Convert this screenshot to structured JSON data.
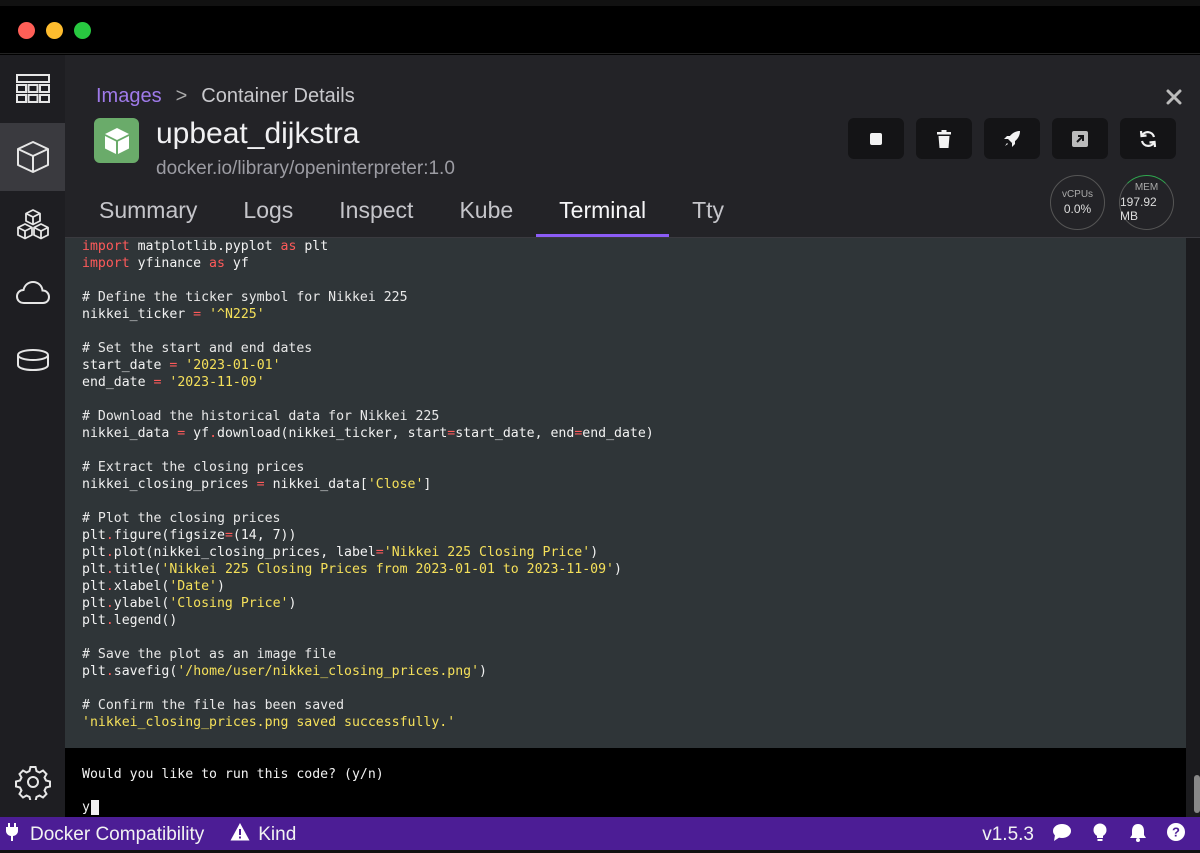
{
  "colors": {
    "accent": "#8b5cf6",
    "statusbar": "#4c1d95",
    "breadcrumb_link": "#9f7aea",
    "container_icon": "#6aab6a"
  },
  "breadcrumb": {
    "parent": "Images",
    "separator": ">",
    "current": "Container Details"
  },
  "container": {
    "name": "upbeat_dijkstra",
    "image": "docker.io/library/openinterpreter:1.0"
  },
  "actions": [
    "stop-icon",
    "trash-icon",
    "rocket-icon",
    "external-link-icon",
    "refresh-icon"
  ],
  "stats": {
    "cpu": {
      "label": "vCPUs",
      "value": "0.0%"
    },
    "mem": {
      "label": "MEM",
      "value": "197.92 MB"
    }
  },
  "tabs": [
    {
      "label": "Summary"
    },
    {
      "label": "Logs"
    },
    {
      "label": "Inspect"
    },
    {
      "label": "Kube"
    },
    {
      "label": "Terminal",
      "active": true
    },
    {
      "label": "Tty"
    }
  ],
  "code_lines": [
    [
      [
        "kw",
        "import"
      ],
      [
        "t",
        " matplotlib.pyplot "
      ],
      [
        "kw",
        "as"
      ],
      [
        "t",
        " plt"
      ]
    ],
    [
      [
        "kw",
        "import"
      ],
      [
        "t",
        " yfinance "
      ],
      [
        "kw",
        "as"
      ],
      [
        "t",
        " yf"
      ]
    ],
    [],
    [
      [
        "cm",
        "# Define the ticker symbol for Nikkei 225"
      ]
    ],
    [
      [
        "t",
        "nikkei_ticker "
      ],
      [
        "op",
        "="
      ],
      [
        "t",
        " "
      ],
      [
        "str",
        "'^N225'"
      ]
    ],
    [],
    [
      [
        "cm",
        "# Set the start and end dates"
      ]
    ],
    [
      [
        "t",
        "start_date "
      ],
      [
        "op",
        "="
      ],
      [
        "t",
        " "
      ],
      [
        "str",
        "'2023-01-01'"
      ]
    ],
    [
      [
        "t",
        "end_date "
      ],
      [
        "op",
        "="
      ],
      [
        "t",
        " "
      ],
      [
        "str",
        "'2023-11-09'"
      ]
    ],
    [],
    [
      [
        "cm",
        "# Download the historical data for Nikkei 225"
      ]
    ],
    [
      [
        "t",
        "nikkei_data "
      ],
      [
        "op",
        "="
      ],
      [
        "t",
        " yf"
      ],
      [
        "op",
        "."
      ],
      [
        "t",
        "download(nikkei_ticker, start"
      ],
      [
        "op",
        "="
      ],
      [
        "t",
        "start_date, end"
      ],
      [
        "op",
        "="
      ],
      [
        "t",
        "end_date)"
      ]
    ],
    [],
    [
      [
        "cm",
        "# Extract the closing prices"
      ]
    ],
    [
      [
        "t",
        "nikkei_closing_prices "
      ],
      [
        "op",
        "="
      ],
      [
        "t",
        " nikkei_data["
      ],
      [
        "str",
        "'Close'"
      ],
      [
        "t",
        "]"
      ]
    ],
    [],
    [
      [
        "cm",
        "# Plot the closing prices"
      ]
    ],
    [
      [
        "t",
        "plt"
      ],
      [
        "op",
        "."
      ],
      [
        "t",
        "figure(figsize"
      ],
      [
        "op",
        "="
      ],
      [
        "t",
        "(14, 7))"
      ]
    ],
    [
      [
        "t",
        "plt"
      ],
      [
        "op",
        "."
      ],
      [
        "t",
        "plot(nikkei_closing_prices, label"
      ],
      [
        "op",
        "="
      ],
      [
        "str",
        "'Nikkei 225 Closing Price'"
      ],
      [
        "t",
        ")"
      ]
    ],
    [
      [
        "t",
        "plt"
      ],
      [
        "op",
        "."
      ],
      [
        "t",
        "title("
      ],
      [
        "str",
        "'Nikkei 225 Closing Prices from 2023-01-01 to 2023-11-09'"
      ],
      [
        "t",
        ")"
      ]
    ],
    [
      [
        "t",
        "plt"
      ],
      [
        "op",
        "."
      ],
      [
        "t",
        "xlabel("
      ],
      [
        "str",
        "'Date'"
      ],
      [
        "t",
        ")"
      ]
    ],
    [
      [
        "t",
        "plt"
      ],
      [
        "op",
        "."
      ],
      [
        "t",
        "ylabel("
      ],
      [
        "str",
        "'Closing Price'"
      ],
      [
        "t",
        ")"
      ]
    ],
    [
      [
        "t",
        "plt"
      ],
      [
        "op",
        "."
      ],
      [
        "t",
        "legend()"
      ]
    ],
    [],
    [
      [
        "cm",
        "# Save the plot as an image file"
      ]
    ],
    [
      [
        "t",
        "plt"
      ],
      [
        "op",
        "."
      ],
      [
        "t",
        "savefig("
      ],
      [
        "str",
        "'/home/user/nikkei_closing_prices.png'"
      ],
      [
        "t",
        ")"
      ]
    ],
    [],
    [
      [
        "cm",
        "# Confirm the file has been saved"
      ]
    ],
    [
      [
        "str",
        "'nikkei_closing_prices.png saved successfully.'"
      ]
    ]
  ],
  "terminal": {
    "prompt": "Would you like to run this code? (y/n)",
    "answer": "y"
  },
  "statusbar": {
    "compat_label": "Docker Compatibility",
    "kind_label": "Kind",
    "version": "v1.5.3"
  }
}
